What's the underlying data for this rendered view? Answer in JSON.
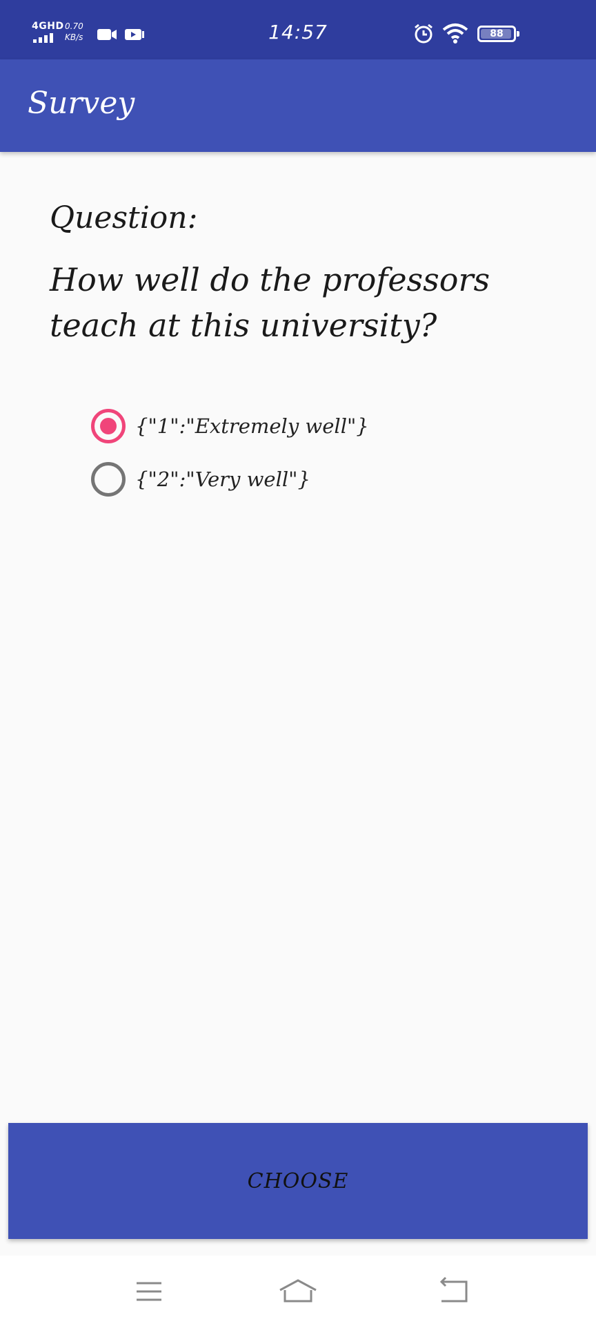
{
  "status_bar": {
    "network_type": "4GHD",
    "net_speed_value": "0.70",
    "net_speed_unit": "KB/s",
    "time": "14:57",
    "battery_level": "88",
    "icons": [
      "signal-bars-icon",
      "screen-record-icon",
      "video-play-icon",
      "alarm-icon",
      "wifi-icon",
      "battery-icon"
    ]
  },
  "app_bar": {
    "title": "Survey"
  },
  "question": {
    "label": "Question:",
    "text": "How well do the professors teach at this university?"
  },
  "options": [
    {
      "label": "{\"1\":\"Extremely well\"}",
      "checked": true
    },
    {
      "label": "{\"2\":\"Very well\"}",
      "checked": false
    }
  ],
  "choose_button": {
    "label": "CHOOSE"
  },
  "nav_bar": {
    "icons": [
      "menu-icon",
      "home-icon",
      "back-icon"
    ]
  },
  "colors": {
    "status_bar": "#2f3d9e",
    "primary": "#3f51b5",
    "accent": "#f0457a",
    "background": "#fafafa"
  }
}
